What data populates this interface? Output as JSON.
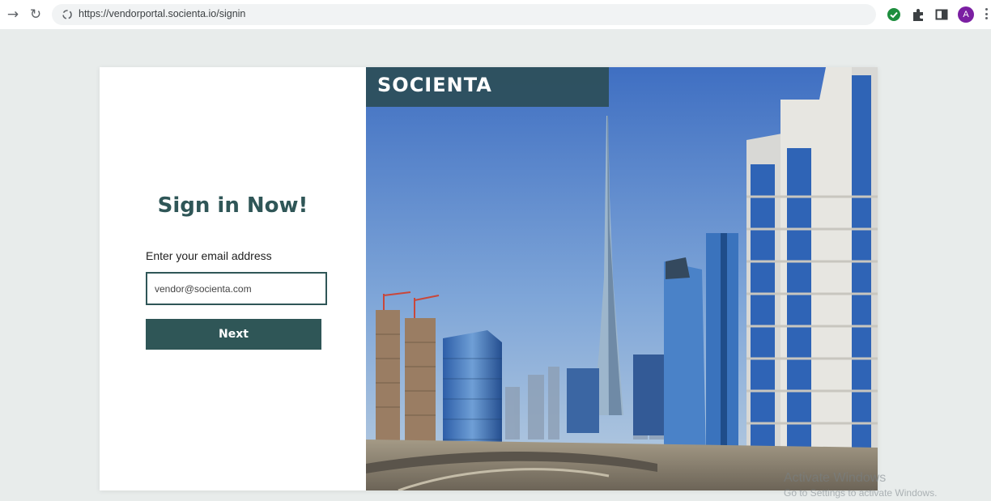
{
  "browser": {
    "url": "https://vendorportal.socienta.io/signin",
    "profile_initial": "A",
    "icons": [
      "back-icon",
      "reload-icon",
      "site-info-icon",
      "extension-check-icon",
      "extensions-puzzle-icon",
      "side-panel-icon",
      "profile-avatar",
      "menu-kebab-icon"
    ]
  },
  "signin": {
    "title": "Sign in Now!",
    "email_label": "Enter your email address",
    "email_value": "vendor@socienta.com",
    "next_label": "Next"
  },
  "brand": {
    "logo_text": "SOCIENTA",
    "primary_color": "#2f5657"
  },
  "watermark": {
    "line1": "Activate Windows",
    "line2": "Go to Settings to activate Windows."
  }
}
